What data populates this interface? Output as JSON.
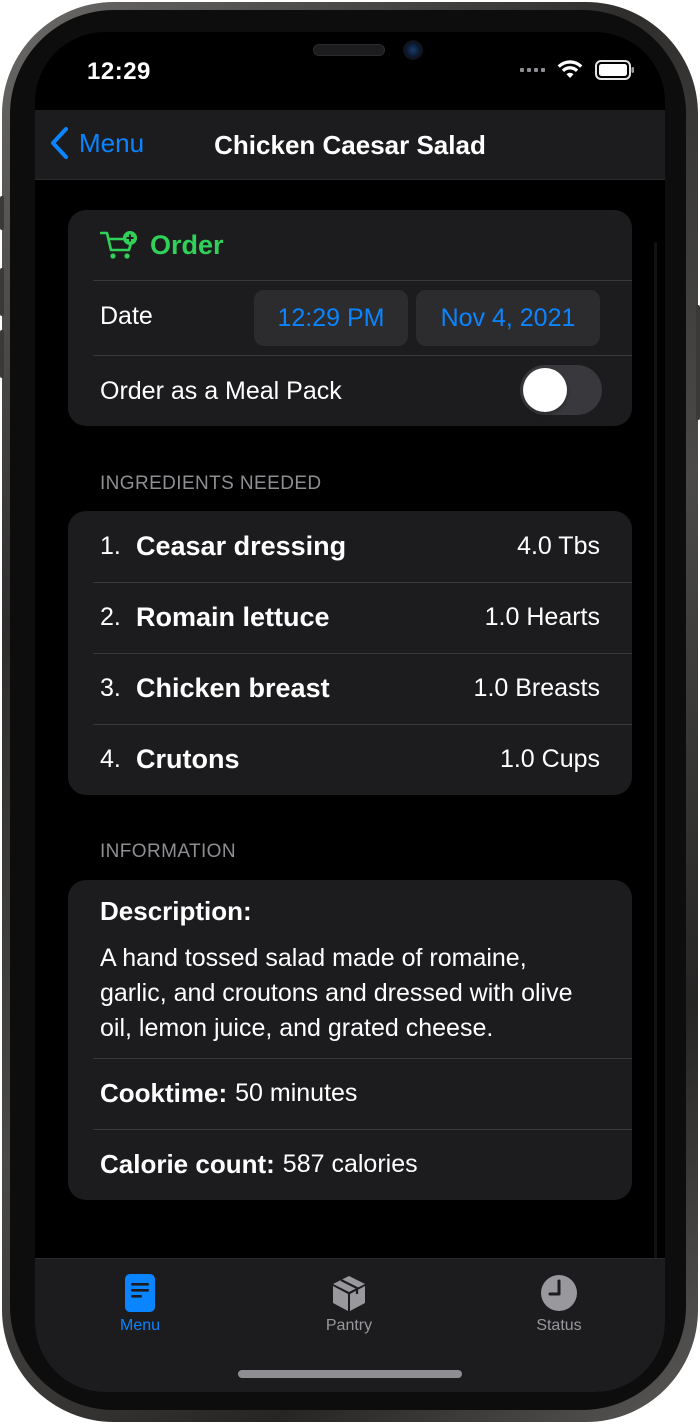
{
  "status_bar": {
    "time": "12:29"
  },
  "navbar": {
    "back_label": "Menu",
    "title": "Chicken Caesar Salad"
  },
  "order": {
    "title": "Order",
    "date_label": "Date",
    "time_value": "12:29 PM",
    "date_value": "Nov 4, 2021",
    "meal_pack_label": "Order as a Meal Pack",
    "meal_pack_on": false
  },
  "ingredients": {
    "header": "INGREDIENTS NEEDED",
    "items": [
      {
        "num": "1.",
        "name": "Ceasar dressing",
        "amount": "4.0 Tbs"
      },
      {
        "num": "2.",
        "name": "Romain lettuce",
        "amount": "1.0 Hearts"
      },
      {
        "num": "3.",
        "name": "Chicken breast",
        "amount": "1.0 Breasts"
      },
      {
        "num": "4.",
        "name": "Crutons",
        "amount": "1.0 Cups"
      }
    ]
  },
  "information": {
    "header": "INFORMATION",
    "description_title": "Description:",
    "description_text": "A hand tossed salad made of romaine, garlic, and croutons and dressed with olive oil, lemon juice, and grated cheese.",
    "cooktime_key": "Cooktime:",
    "cooktime_value": "50 minutes",
    "calorie_key": "Calorie count:",
    "calorie_value": "587 calories"
  },
  "tabbar": {
    "tabs": [
      {
        "label": "Menu",
        "icon": "menu-doc-icon",
        "active": true
      },
      {
        "label": "Pantry",
        "icon": "box-icon",
        "active": false
      },
      {
        "label": "Status",
        "icon": "clock-icon",
        "active": false
      }
    ]
  },
  "colors": {
    "accent": "#0a84ff",
    "order_green": "#30d158",
    "background": "#000000",
    "card": "#1c1c1e",
    "secondary_text": "#8e8e93"
  }
}
